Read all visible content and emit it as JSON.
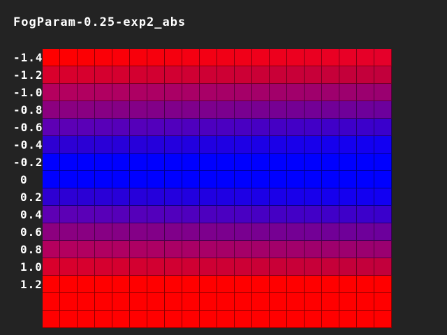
{
  "title": "FogParam-0.25-exp2_abs",
  "row_labels": [
    "-1.4",
    "-1.2",
    "-1.0",
    "-0.8",
    "-0.6",
    "-0.4",
    "-0.2",
    "0",
    "0.2",
    "0.4",
    "0.6",
    "0.8",
    "1.0",
    "1.2",
    "",
    ""
  ],
  "grid": {
    "columns": 20,
    "rows": 16,
    "row_colors": [
      "#ff0000",
      "#d9002c",
      "#b4005e",
      "#8c007f",
      "#5e00b4",
      "#2e00d2",
      "#0000ff",
      "#0000ff",
      "#2e00d2",
      "#5e00b4",
      "#8c007f",
      "#b4005e",
      "#d9002c",
      "#ff0000",
      "#ff0000",
      "#ff0000"
    ],
    "row_colors_right": [
      "#e5002a",
      "#c2003c",
      "#9a0070",
      "#6c009c",
      "#3a00cc",
      "#1200f2",
      "#0000ff",
      "#0000ff",
      "#1200f2",
      "#3a00cc",
      "#6c009c",
      "#9a0070",
      "#c2003c",
      "#ff0000",
      "#ff0000",
      "#ff0000"
    ]
  }
}
